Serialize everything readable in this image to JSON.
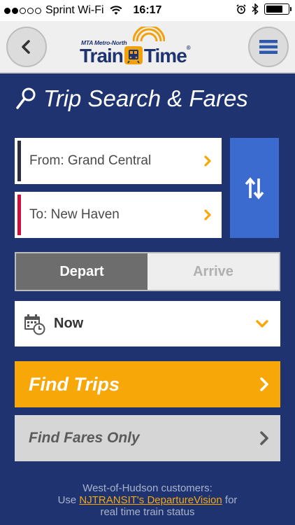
{
  "status_bar": {
    "carrier": "Sprint Wi-Fi",
    "time": "16:17",
    "signal_bars_filled": 2,
    "signal_bars_total": 5,
    "battery_level": 0.8
  },
  "header": {
    "logo_small": "MTA Metro-North",
    "logo_train": "Train",
    "logo_time": "Time",
    "logo_reg": "®",
    "back_icon": "chevron-left-icon",
    "menu_icon": "hamburger-menu-icon"
  },
  "page": {
    "title": "Trip Search & Fares",
    "title_icon": "search-icon"
  },
  "stations": {
    "from_label": "From: Grand Central",
    "to_label": "To: New Haven",
    "from_color": "#2a2e3a",
    "to_color": "#d0103a"
  },
  "mode": {
    "depart_label": "Depart",
    "arrive_label": "Arrive",
    "selected": "Depart"
  },
  "time_select": {
    "value": "Now",
    "icon": "calendar-clock-icon"
  },
  "actions": {
    "find_trips_label": "Find Trips",
    "find_fares_label": "Find Fares Only"
  },
  "footer": {
    "line1": "West-of-Hudson customers:",
    "use_text": "Use ",
    "link_text": "NJTRANSIT's DepartureVision",
    "after_link": " for",
    "line3": "real time train status"
  },
  "colors": {
    "background": "#1e3370",
    "accent": "#f7a808",
    "swap_button": "#3c6bd0"
  }
}
